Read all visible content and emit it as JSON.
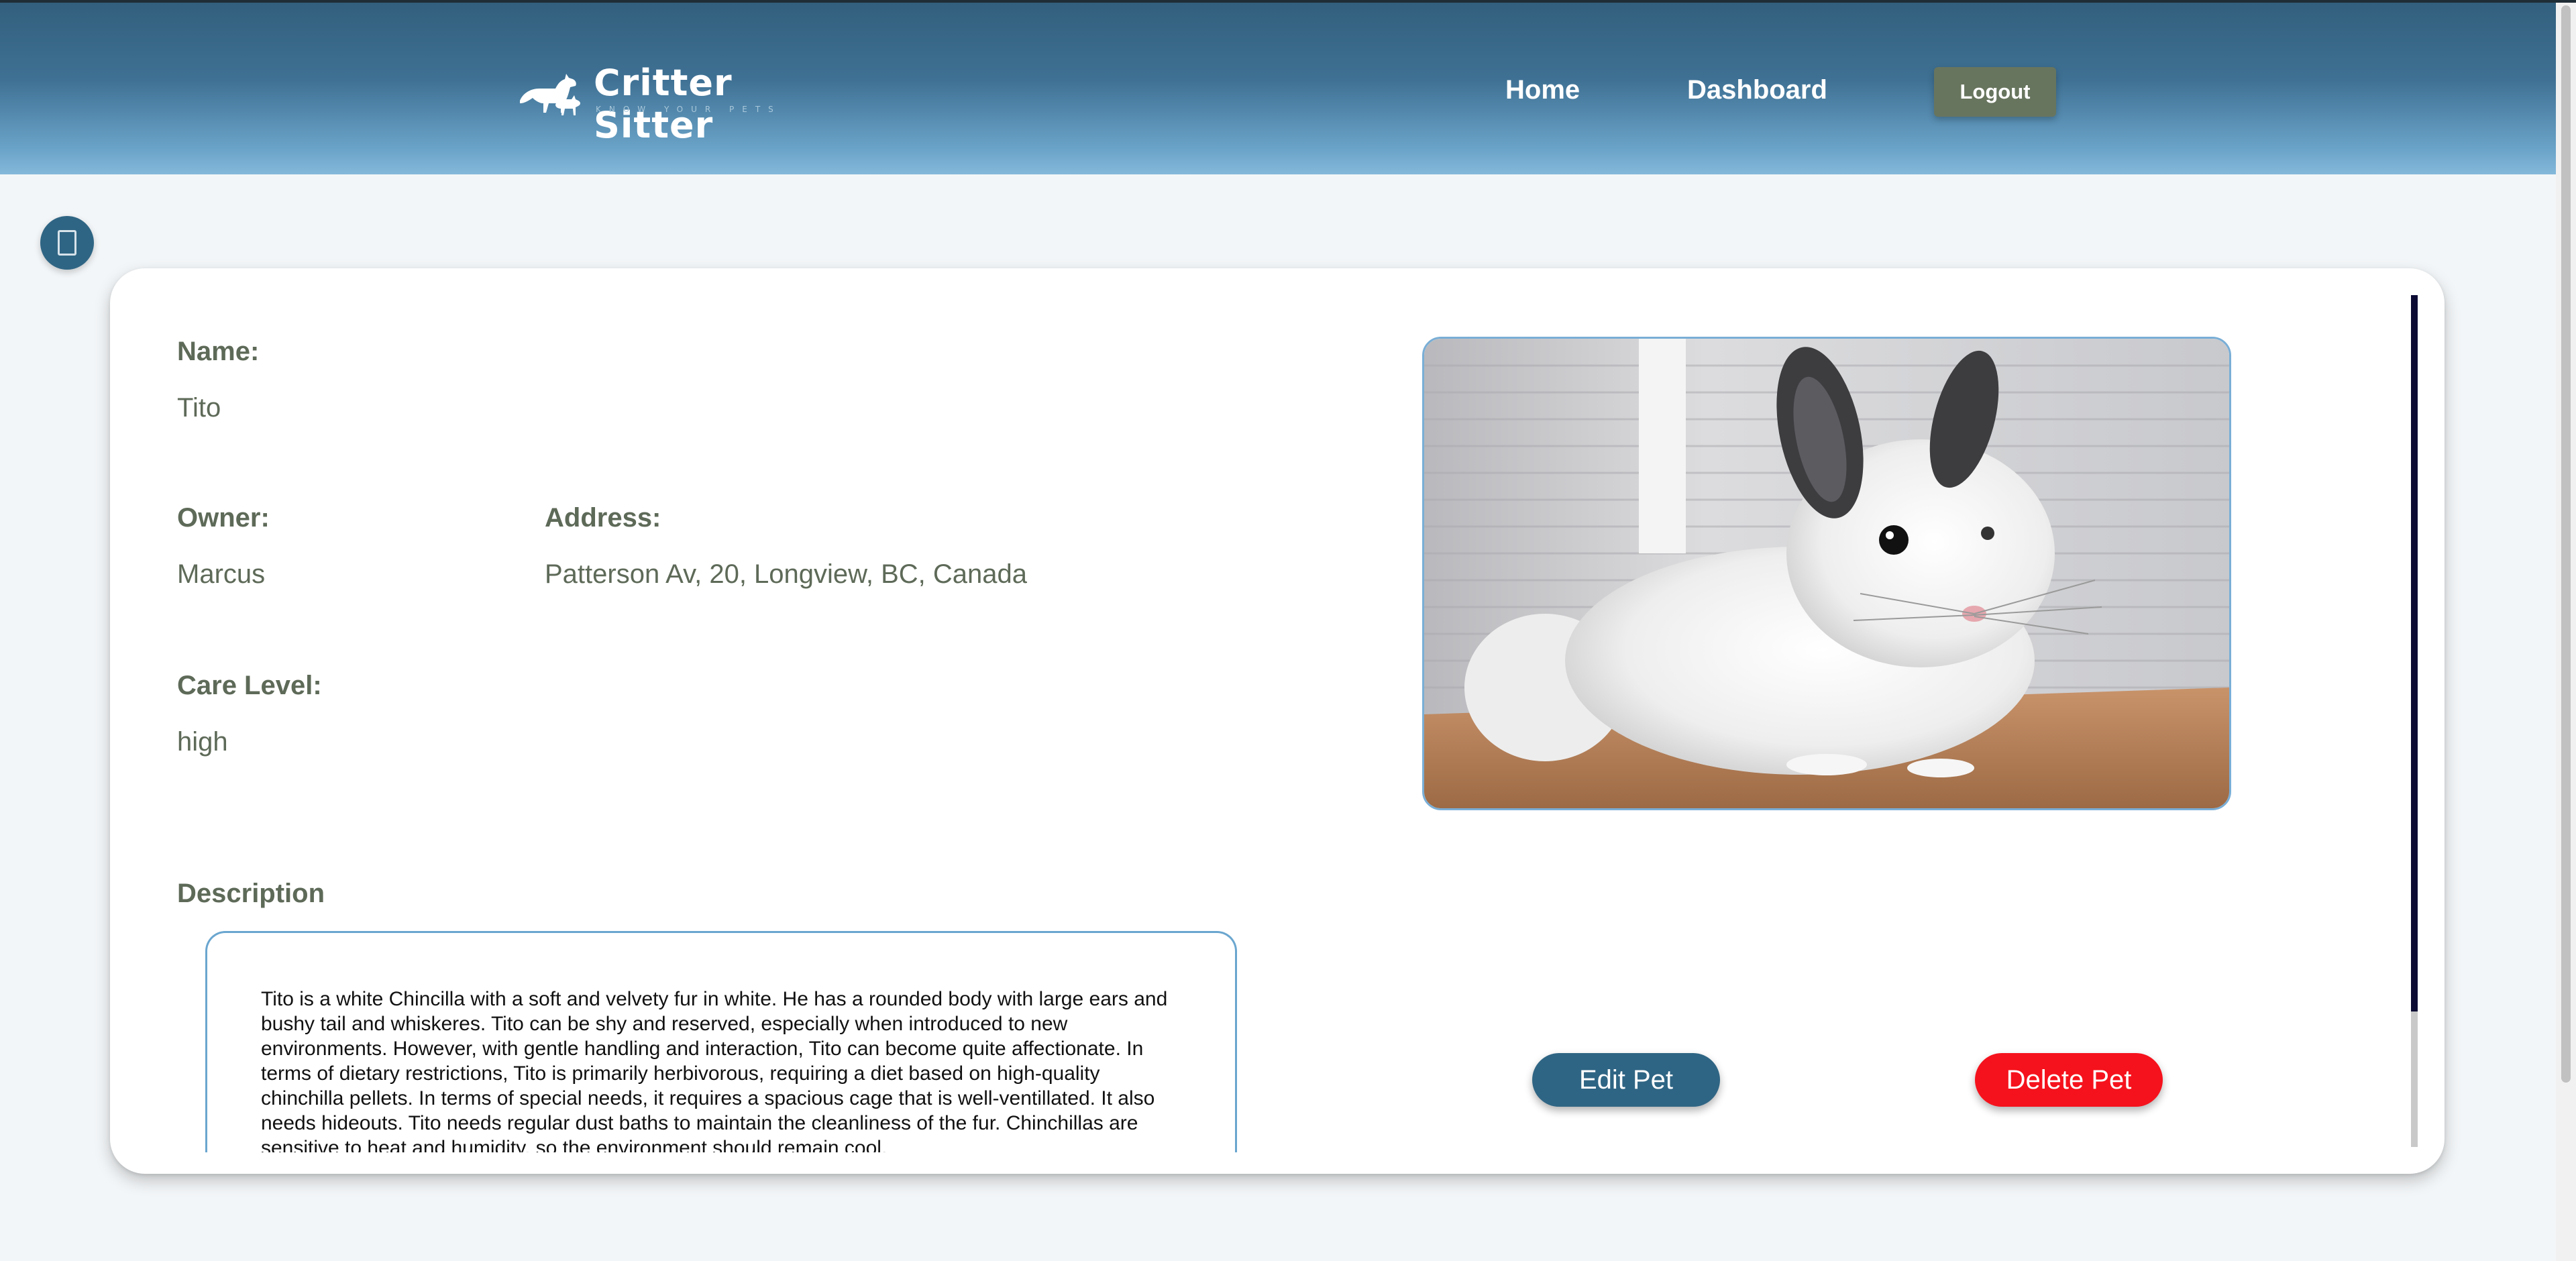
{
  "header": {
    "brand": "Critter Sitter",
    "tagline": "KNOW YOUR PETS",
    "nav": {
      "home": "Home",
      "dashboard": "Dashboard"
    },
    "logout_label": "Logout"
  },
  "pet": {
    "name_label": "Name:",
    "name": "Tito",
    "owner_label": "Owner:",
    "owner": "Marcus",
    "address_label": "Address:",
    "address": "Patterson Av, 20, Longview, BC, Canada",
    "care_label": "Care Level:",
    "care_level": "high",
    "description_label": "Description",
    "description": "Tito is a white Chincilla with a soft and velvety fur in white. He has a rounded body with large ears and bushy tail and whiskeres. Tito can be shy and reserved, especially when introduced to new environments. However, with gentle handling and interaction, Tito can become quite affectionate. In terms of dietary restrictions, Tito is primarily herbivorous, requiring a diet based on high-quality chinchilla pellets. In terms of special needs, it requires a spacious cage that is well-ventillated. It also needs hideouts. Tito needs regular dust baths to maintain the cleanliness of the fur. Chinchillas are sensitive to heat and humidity, so the environment should remain cool."
  },
  "actions": {
    "edit": "Edit Pet",
    "delete": "Delete Pet"
  },
  "icons": {
    "logo": "dog-cat-silhouette-icon",
    "back": "back-icon"
  },
  "colors": {
    "primary": "#2f6584",
    "danger": "#f5121c",
    "logout": "#68755e",
    "label": "#5e6a58"
  }
}
